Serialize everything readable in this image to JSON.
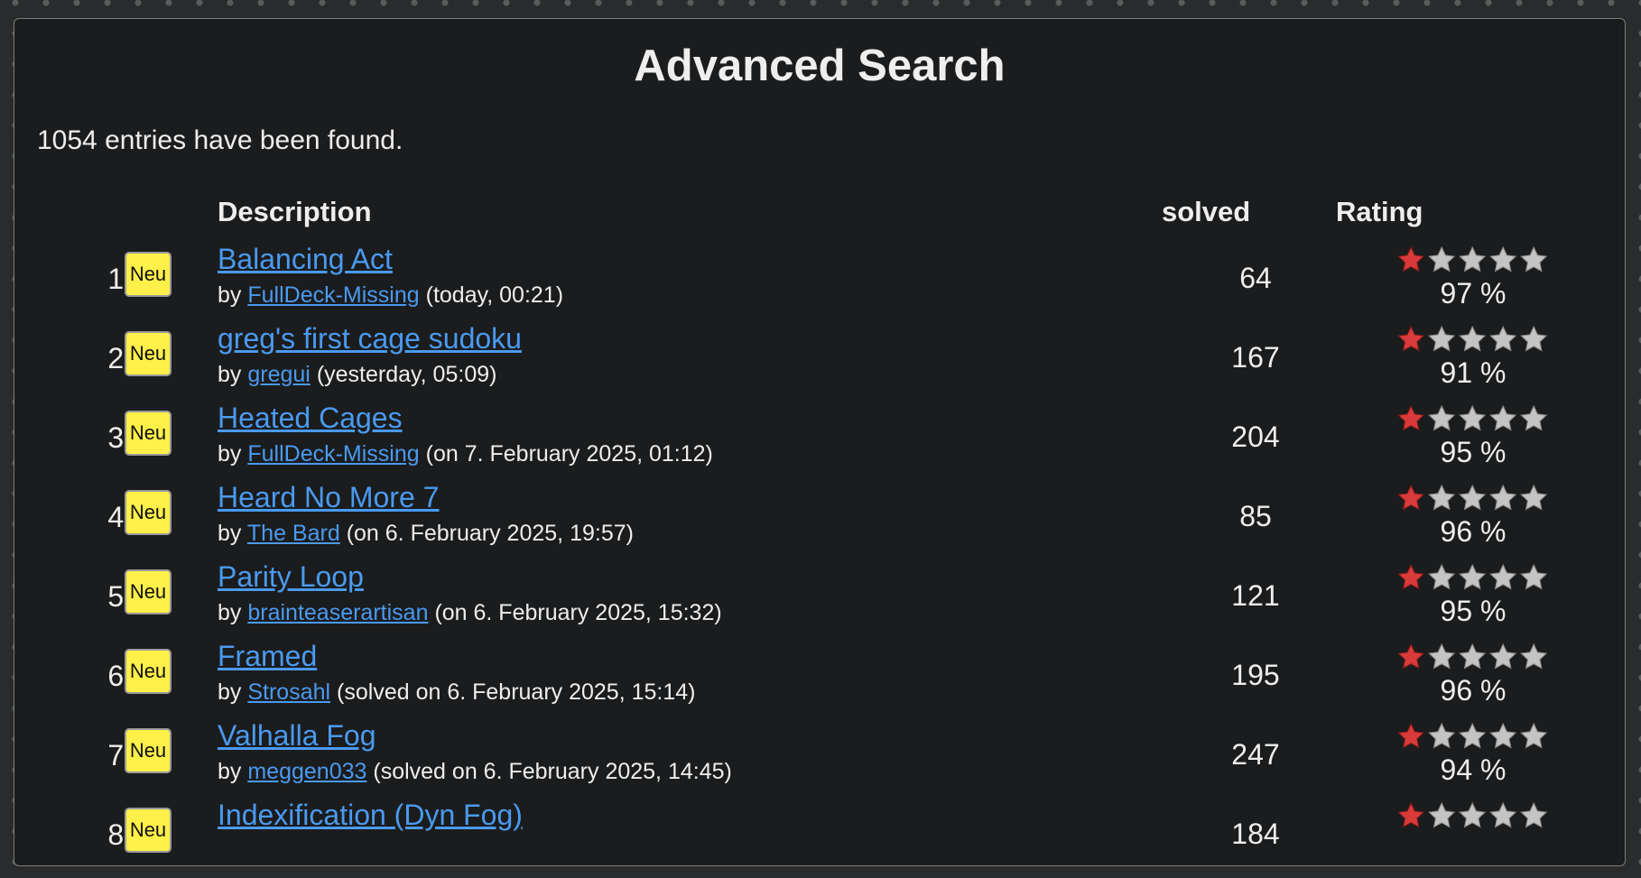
{
  "page": {
    "title": "Advanced Search",
    "found_text": "1054 entries have been found."
  },
  "table": {
    "headers": {
      "description": "Description",
      "solved": "solved",
      "rating": "Rating"
    },
    "badge_label": "Neu",
    "rows": [
      {
        "num": "1.",
        "title": "Balancing Act",
        "by": "by",
        "author": "FullDeck-Missing",
        "when": "(today, 00:21)",
        "solved": "64",
        "stars_filled": 1,
        "stars_total": 5,
        "rating": "97 %"
      },
      {
        "num": "2.",
        "title": "greg's first cage sudoku",
        "by": "by",
        "author": "gregui",
        "when": "(yesterday, 05:09)",
        "solved": "167",
        "stars_filled": 1,
        "stars_total": 5,
        "rating": "91 %"
      },
      {
        "num": "3.",
        "title": "Heated Cages",
        "by": "by",
        "author": "FullDeck-Missing",
        "when": "(on 7. February 2025, 01:12)",
        "solved": "204",
        "stars_filled": 1,
        "stars_total": 5,
        "rating": "95 %"
      },
      {
        "num": "4.",
        "title": "Heard No More 7",
        "by": "by",
        "author": "The Bard",
        "when": "(on 6. February 2025, 19:57)",
        "solved": "85",
        "stars_filled": 1,
        "stars_total": 5,
        "rating": "96 %"
      },
      {
        "num": "5.",
        "title": "Parity Loop",
        "by": "by",
        "author": "brainteaserartisan",
        "when": "(on 6. February 2025, 15:32)",
        "solved": "121",
        "stars_filled": 1,
        "stars_total": 5,
        "rating": "95 %"
      },
      {
        "num": "6.",
        "title": "Framed",
        "by": "by",
        "author": "Strosahl",
        "when": "(solved on 6. February 2025, 15:14)",
        "solved": "195",
        "stars_filled": 1,
        "stars_total": 5,
        "rating": "96 %"
      },
      {
        "num": "7.",
        "title": "Valhalla Fog",
        "by": "by",
        "author": "meggen033",
        "when": "(solved on 6. February 2025, 14:45)",
        "solved": "247",
        "stars_filled": 1,
        "stars_total": 5,
        "rating": "94 %"
      },
      {
        "num": "8.",
        "title": "Indexification (Dyn Fog)",
        "by": "",
        "author": "",
        "when": "",
        "solved": "184",
        "stars_filled": 1,
        "stars_total": 5,
        "rating": ""
      }
    ]
  },
  "colors": {
    "link": "#4a9af0",
    "badge_bg": "#fff04a",
    "star_filled": "#d93a3a",
    "star_empty": "#c4c4c4",
    "panel_bg": "#1b1c1d"
  },
  "icons": {
    "badge": "new-badge-icon",
    "star": "star-icon"
  }
}
